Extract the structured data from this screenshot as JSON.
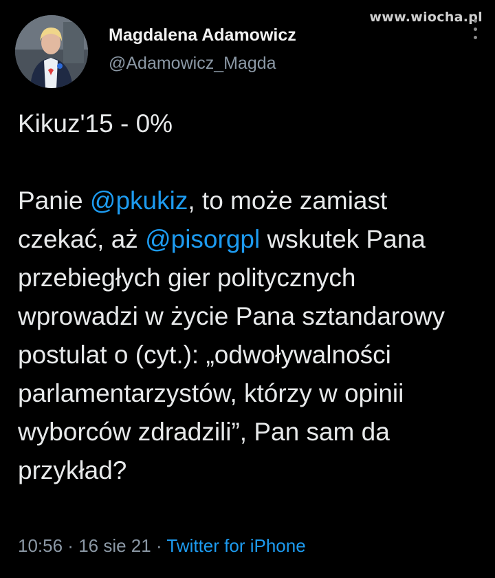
{
  "watermark": "www.wiocha.pl",
  "author": {
    "name": "Magdalena Adamowicz",
    "handle": "@Adamowicz_Magda"
  },
  "tweet": {
    "line1": "Kikuz'15 - 0%",
    "p2_a": "Panie ",
    "mention1": "@pkukiz",
    "p2_b": ", to może zamiast czekać, aż ",
    "mention2": "@pisorgpl",
    "p2_c": " wskutek Pana przebiegłych gier politycznych wprowadzi w życie Pana sztandarowy postulat o (cyt.): „odwoływalności parlamentarzystów, którzy w opinii wyborców zdradzili”, Pan sam da przykład?"
  },
  "meta": {
    "time": "10:56",
    "sep1": " · ",
    "date": "16 sie 21",
    "sep2": " · ",
    "source": "Twitter for iPhone"
  },
  "colors": {
    "background": "#000000",
    "text": "#e7e9ea",
    "muted": "#8b98a5",
    "link": "#1d9bf0"
  },
  "icons": [
    "more-options-icon",
    "avatar-photo"
  ]
}
